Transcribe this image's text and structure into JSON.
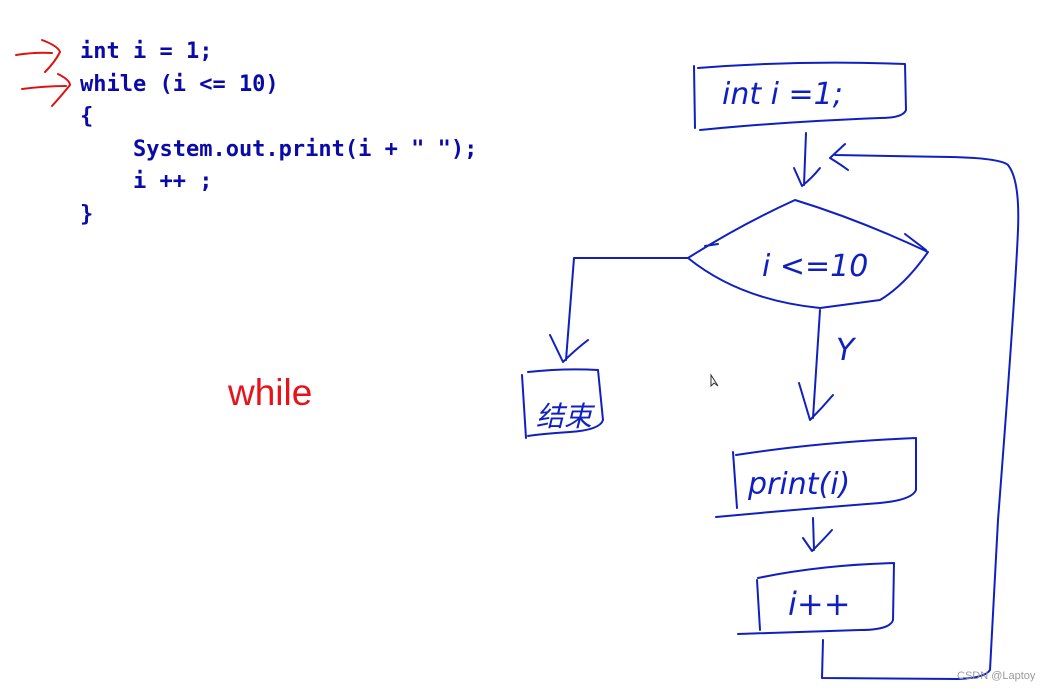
{
  "code": {
    "lines": [
      "int i = 1;",
      "while (i <= 10)",
      "{",
      "    System.out.print(i + \" \");",
      "    i ++ ;",
      "}"
    ]
  },
  "caption": "while",
  "flowchart": {
    "init": "int i =1;",
    "condition": "i <=10",
    "yes_label": "Y",
    "end": "结束",
    "print": "print(i)",
    "increment": "i++"
  },
  "watermark": "CSDN @Laptoy",
  "colors": {
    "code": "#0a0aa8",
    "ink": "#1020c0",
    "caption": "#e8121a",
    "arrows": "#e01010"
  }
}
